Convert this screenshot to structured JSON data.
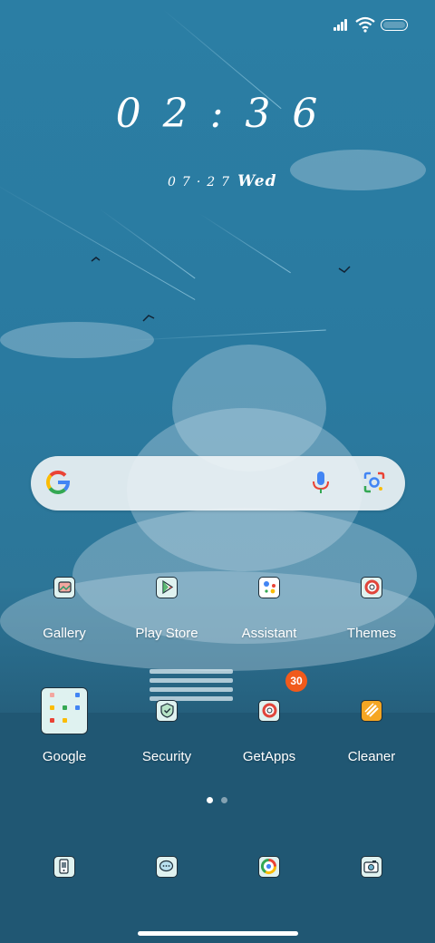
{
  "clock": {
    "time": "02:36",
    "date": "07·27",
    "weekday": "Wed"
  },
  "search": {
    "logo": "google-g-icon",
    "voice_icon": "microphone-icon",
    "lens_icon": "google-lens-icon"
  },
  "apps": [
    {
      "label": "Gallery",
      "icon": "gallery-icon"
    },
    {
      "label": "Play Store",
      "icon": "play-store-icon"
    },
    {
      "label": "Assistant",
      "icon": "assistant-icon"
    },
    {
      "label": "Themes",
      "icon": "themes-icon"
    },
    {
      "label": "Google",
      "icon": "google-folder-icon"
    },
    {
      "label": "Security",
      "icon": "security-icon"
    },
    {
      "label": "GetApps",
      "icon": "getapps-icon",
      "badge": "30"
    },
    {
      "label": "Cleaner",
      "icon": "cleaner-icon"
    }
  ],
  "page_indicator": {
    "pages": 2,
    "current": 1
  },
  "dock": [
    {
      "icon": "phone-icon"
    },
    {
      "icon": "messages-icon"
    },
    {
      "icon": "browser-icon"
    },
    {
      "icon": "camera-icon"
    }
  ],
  "colors": {
    "badge": "#f15a1b",
    "icon_bg": "#dff2f0",
    "icon_outline": "#1e2f3a"
  }
}
